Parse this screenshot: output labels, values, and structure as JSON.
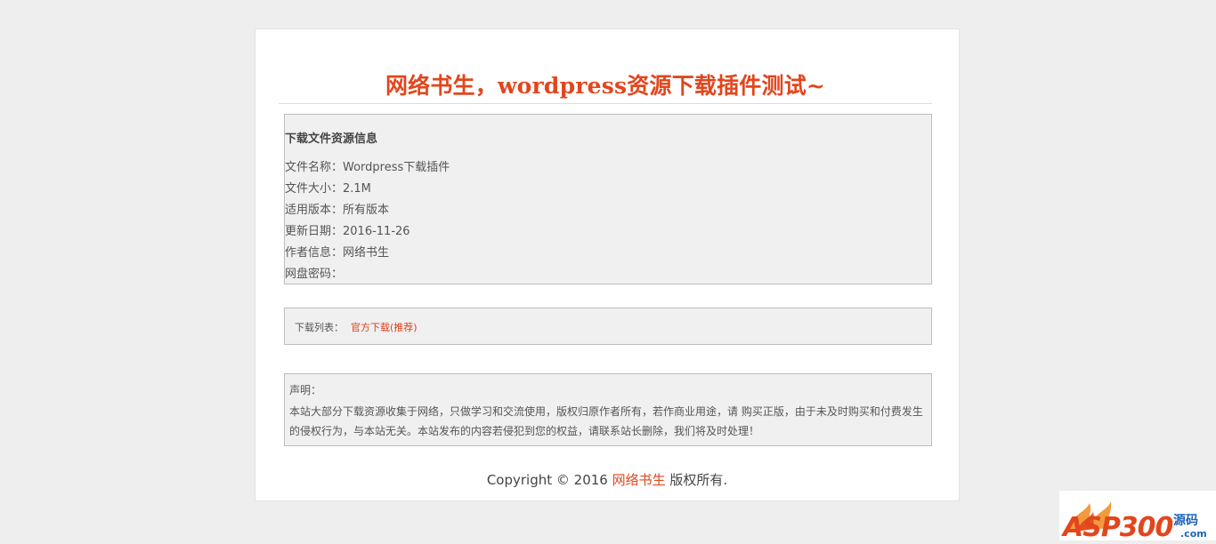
{
  "page": {
    "title": "网络书生，wordpress资源下载插件测试~"
  },
  "info": {
    "heading": "下载文件资源信息",
    "rows": [
      "文件名称：Wordpress下载插件",
      "文件大小：2.1M",
      "适用版本：所有版本",
      "更新日期：2016-11-26",
      "作者信息：网络书生",
      "网盘密码："
    ]
  },
  "download": {
    "label": "下载列表：",
    "link": "官方下载(推荐)"
  },
  "notice": {
    "title": "声明：",
    "body": "本站大部分下载资源收集于网络，只做学习和交流使用，版权归原作者所有，若作商业用途，请 购买正版，由于未及时购买和付费发生的侵权行为，与本站无关。本站发布的内容若侵犯到您的权益，请联系站长删除，我们将及时处理！"
  },
  "footer": {
    "prefix": "Copyright © 2016 ",
    "brand": "网络书生",
    "suffix": " 版权所有."
  },
  "watermark": {
    "text": "ASP300",
    "sub": "源码",
    "domain": ".com"
  },
  "colors": {
    "accent": "#e2461d",
    "background": "#eeeeee",
    "box": "#f0f0f0"
  }
}
